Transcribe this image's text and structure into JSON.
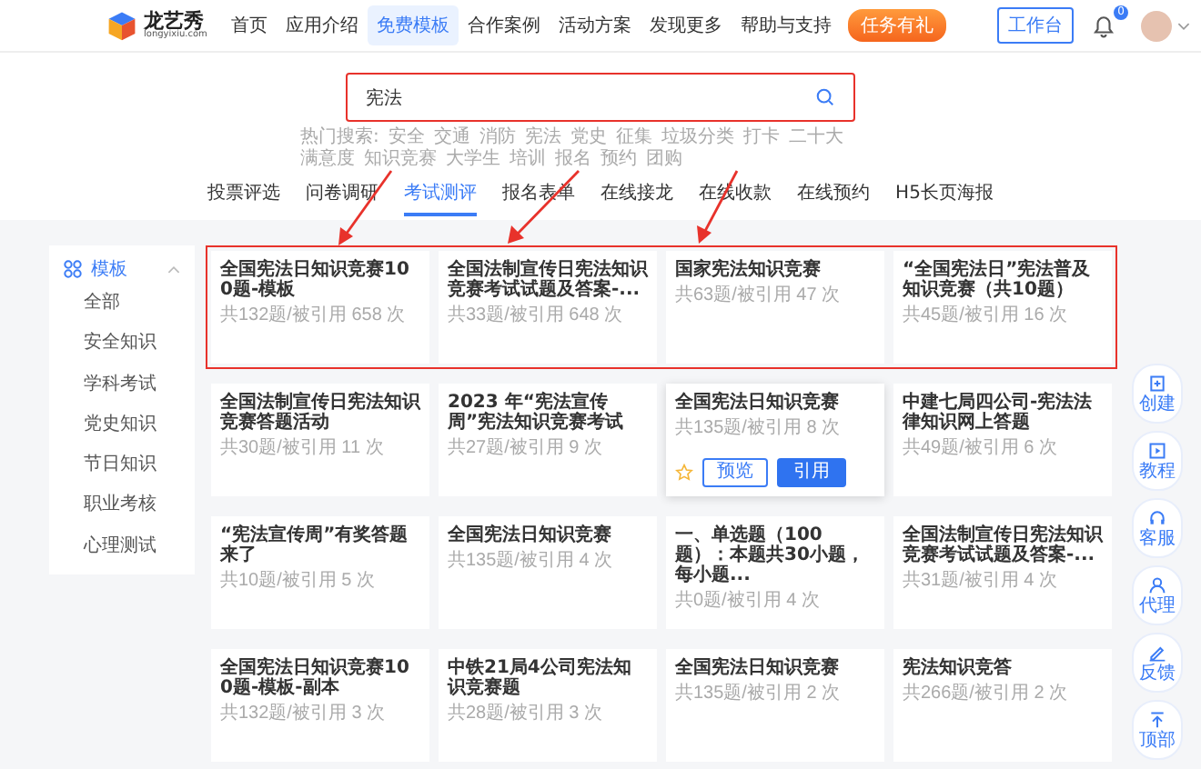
{
  "header": {
    "logo_name": "龙艺秀",
    "logo_domain": "longyixiu.com",
    "nav": [
      {
        "label": "首页",
        "selected": false
      },
      {
        "label": "应用介绍",
        "selected": false
      },
      {
        "label": "免费模板",
        "selected": true
      },
      {
        "label": "合作案例",
        "selected": false
      },
      {
        "label": "活动方案",
        "selected": false
      },
      {
        "label": "发现更多",
        "selected": false
      },
      {
        "label": "帮助与支持",
        "selected": false
      }
    ],
    "promo_button": "任务有礼",
    "workbench_button": "工作台",
    "notification_count": "0"
  },
  "search": {
    "value": "宪法",
    "highlighted": true,
    "hot_label": "热门搜索:",
    "hot_terms": [
      "安全",
      "交通",
      "消防",
      "宪法",
      "党史",
      "征集",
      "垃圾分类",
      "打卡",
      "二十大",
      "满意度",
      "知识竞赛",
      "大学生",
      "培训",
      "报名",
      "预约",
      "团购"
    ]
  },
  "category_tabs": [
    {
      "label": "投票评选",
      "selected": false
    },
    {
      "label": "问卷调研",
      "selected": false
    },
    {
      "label": "考试测评",
      "selected": true
    },
    {
      "label": "报名表单",
      "selected": false
    },
    {
      "label": "在线接龙",
      "selected": false
    },
    {
      "label": "在线收款",
      "selected": false
    },
    {
      "label": "在线预约",
      "selected": false
    },
    {
      "label": "H5长页海报",
      "selected": false
    }
  ],
  "sidebar": {
    "title": "模板",
    "expanded": true,
    "items": [
      {
        "label": "全部",
        "selected": false
      },
      {
        "label": "安全知识",
        "selected": false
      },
      {
        "label": "学科考试",
        "selected": false
      },
      {
        "label": "党史知识",
        "selected": false
      },
      {
        "label": "节日知识",
        "selected": false
      },
      {
        "label": "职业考核",
        "selected": false
      },
      {
        "label": "心理测试",
        "selected": false
      }
    ]
  },
  "card_rows": [
    {
      "highlighted": true,
      "cards": [
        {
          "title": "全国宪法日知识竞赛100题-模板",
          "meta": "共132题/被引用 658 次",
          "hovered": false
        },
        {
          "title": "全国法制宣传日宪法知识竞赛考试试题及答案-...",
          "meta": "共33题/被引用 648 次",
          "hovered": false
        },
        {
          "title": "国家宪法知识竞赛",
          "meta": "共63题/被引用 47 次",
          "hovered": false
        },
        {
          "title": "“全国宪法日”宪法普及知识竞赛（共10题）",
          "meta": "共45题/被引用 16 次",
          "hovered": false
        }
      ]
    },
    {
      "highlighted": false,
      "cards": [
        {
          "title": "全国法制宣传日宪法知识竞赛答题活动",
          "meta": "共30题/被引用 11 次",
          "hovered": false
        },
        {
          "title": "2023 年“宪法宣传周”宪法知识竞赛考试",
          "meta": "共27题/被引用 9 次",
          "hovered": false
        },
        {
          "title": "全国宪法日知识竞赛",
          "meta": "共135题/被引用 8 次",
          "hovered": true,
          "preview_label": "预览",
          "use_label": "引用"
        },
        {
          "title": "中建七局四公司-宪法法律知识网上答题",
          "meta": "共49题/被引用 6 次",
          "hovered": false
        }
      ]
    },
    {
      "highlighted": false,
      "cards": [
        {
          "title": "“宪法宣传周”有奖答题来了",
          "meta": "共10题/被引用 5 次",
          "hovered": false
        },
        {
          "title": "全国宪法日知识竞赛",
          "meta": "共135题/被引用 4 次",
          "hovered": false
        },
        {
          "title": "一、单选题（100题）：本题共30小题，每小题...",
          "meta": "共0题/被引用 4 次",
          "hovered": false
        },
        {
          "title": "全国法制宣传日宪法知识竞赛考试试题及答案-...",
          "meta": "共31题/被引用 4 次",
          "hovered": false
        }
      ]
    },
    {
      "highlighted": false,
      "cards": [
        {
          "title": "全国宪法日知识竞赛100题-模板-副本",
          "meta": "共132题/被引用 3 次",
          "hovered": false
        },
        {
          "title": "中铁21局4公司宪法知识竞赛题",
          "meta": "共28题/被引用 3 次",
          "hovered": false
        },
        {
          "title": "全国宪法日知识竞赛",
          "meta": "共135题/被引用 2 次",
          "hovered": false
        },
        {
          "title": "宪法知识竞答",
          "meta": "共266题/被引用 2 次",
          "hovered": false
        }
      ]
    }
  ],
  "float_buttons": [
    {
      "kind": "create",
      "label": "创建"
    },
    {
      "kind": "tutorial",
      "label": "教程"
    },
    {
      "kind": "service",
      "label": "客服"
    },
    {
      "kind": "agent",
      "label": "代理"
    },
    {
      "kind": "feedback",
      "label": "反馈"
    },
    {
      "kind": "top",
      "label": "顶部"
    }
  ]
}
